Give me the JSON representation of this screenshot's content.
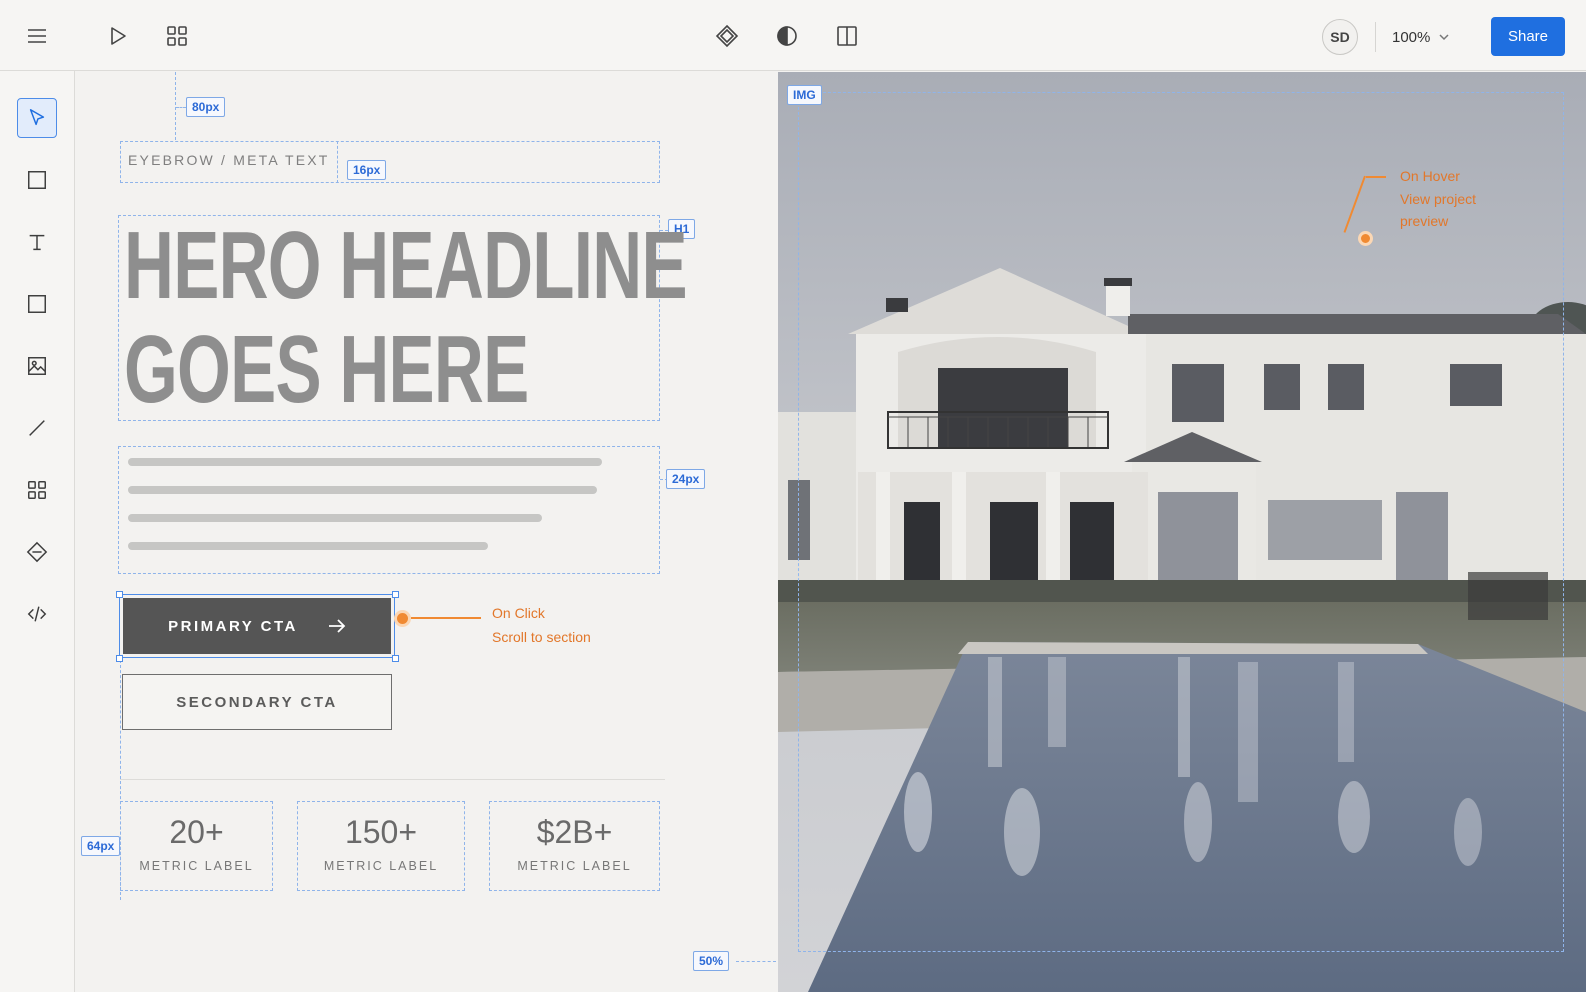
{
  "toolbar": {
    "avatar_initials": "SD",
    "zoom": "100%",
    "share_label": "Share"
  },
  "icons": [
    "menu-icon",
    "play-icon",
    "grid-icon",
    "component-icon",
    "contrast-icon",
    "split-view-icon",
    "chevron-down-icon",
    "pointer-icon",
    "frame-icon",
    "text-icon",
    "rectangle-icon",
    "image-icon",
    "line-icon",
    "components-icon",
    "diamond-icon",
    "code-icon",
    "arrow-right-icon"
  ],
  "specs": {
    "top_spacing": "80px",
    "eyebrow_gap": "16px",
    "headline_tag": "H1",
    "body_gap": "24px",
    "side_spacing": "64px",
    "split": "50%",
    "image_tag": "IMG"
  },
  "hero": {
    "eyebrow": "EYEBROW / META TEXT",
    "headline_line1": "HERO HEADLINE",
    "headline_line2": "GOES HERE",
    "primary_cta": "PRIMARY CTA",
    "secondary_cta": "SECONDARY CTA"
  },
  "annotations": {
    "click_title": "On Click",
    "click_desc": "Scroll to section",
    "hover_title": "On Hover",
    "hover_desc_1": "View project",
    "hover_desc_2": "preview"
  },
  "metrics": [
    {
      "value": "20+",
      "label": "METRIC LABEL"
    },
    {
      "value": "150+",
      "label": "METRIC LABEL"
    },
    {
      "value": "$2B+",
      "label": "METRIC LABEL"
    }
  ],
  "colors": {
    "accent": "#1f6fe0",
    "guide": "#8fb4ea",
    "annotation": "#f08a32",
    "headline": "#8e8e8e",
    "cta": "#555555"
  }
}
